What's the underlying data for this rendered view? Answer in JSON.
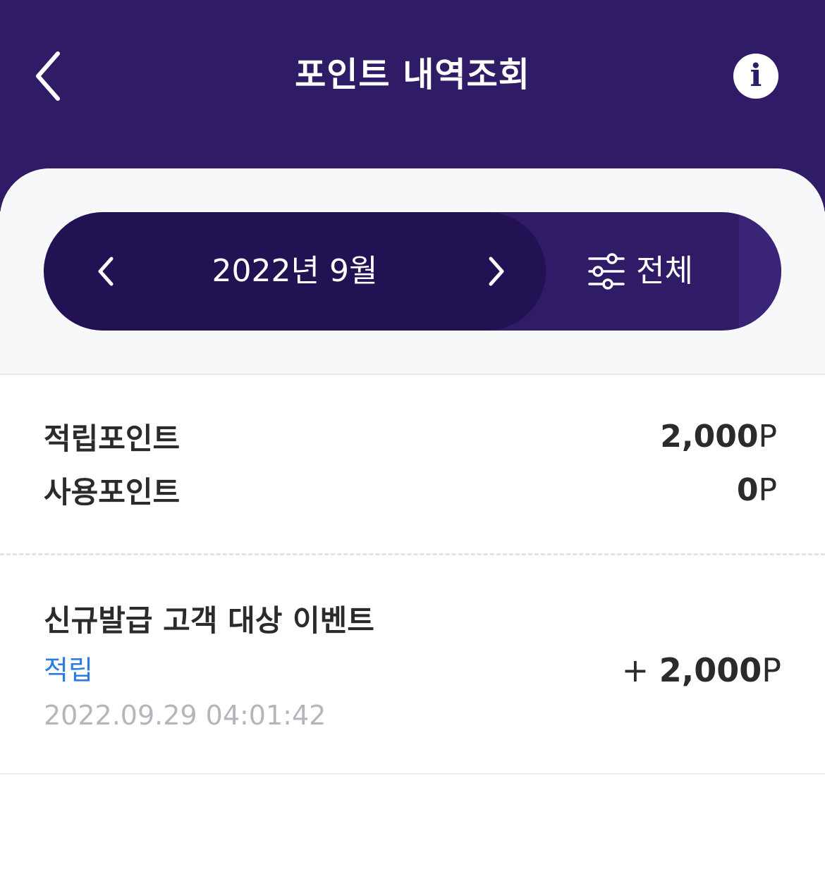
{
  "header": {
    "title": "포인트 내역조회",
    "back_icon": "chevron-left-icon",
    "info_icon": "info-icon",
    "info_glyph": "i"
  },
  "selector": {
    "month_label": "2022년 9월",
    "prev_icon": "chevron-left-icon",
    "next_icon": "chevron-right-icon",
    "filter_icon": "sliders-icon",
    "filter_label": "전체"
  },
  "summary": {
    "earned_label": "적립포인트",
    "earned_value": "2,000",
    "earned_unit": "P",
    "used_label": "사용포인트",
    "used_value": "0",
    "used_unit": "P"
  },
  "transactions": [
    {
      "title": "신규발급 고객 대상 이벤트",
      "type": "적립",
      "datetime": "2022.09.29 04:01:42",
      "sign": "+ ",
      "amount": "2,000",
      "unit": "P"
    }
  ],
  "colors": {
    "header_bg": "#2f1b66",
    "month_pill_bg": "#221254",
    "accent_blue": "#2d7be5",
    "muted_text": "#b4b6bd"
  }
}
